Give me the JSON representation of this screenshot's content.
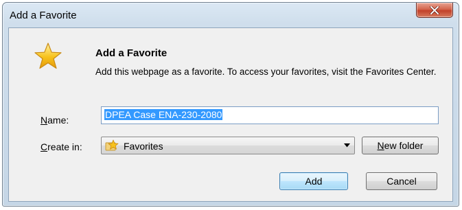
{
  "window": {
    "title": "Add a Favorite",
    "close_icon": "close-icon"
  },
  "header": {
    "heading": "Add a Favorite",
    "description": "Add this webpage as a favorite. To access your favorites, visit the Favorites Center.",
    "icon": "favorite-star-icon"
  },
  "form": {
    "name_label_accel": "N",
    "name_label_rest": "ame:",
    "name_value": "DPEA Case ENA-230-2080",
    "create_label_accel": "C",
    "create_label_rest": "reate in:",
    "create_in_value": "Favorites",
    "create_in_icon": "favorites-folder-star-icon"
  },
  "buttons": {
    "new_folder_accel": "N",
    "new_folder_rest": "ew folder",
    "add": "Add",
    "cancel": "Cancel"
  },
  "colors": {
    "selection": "#3399ff",
    "close_button": "#c2412a",
    "default_button_border": "#3c7fb1",
    "star": "#f7c21c"
  }
}
